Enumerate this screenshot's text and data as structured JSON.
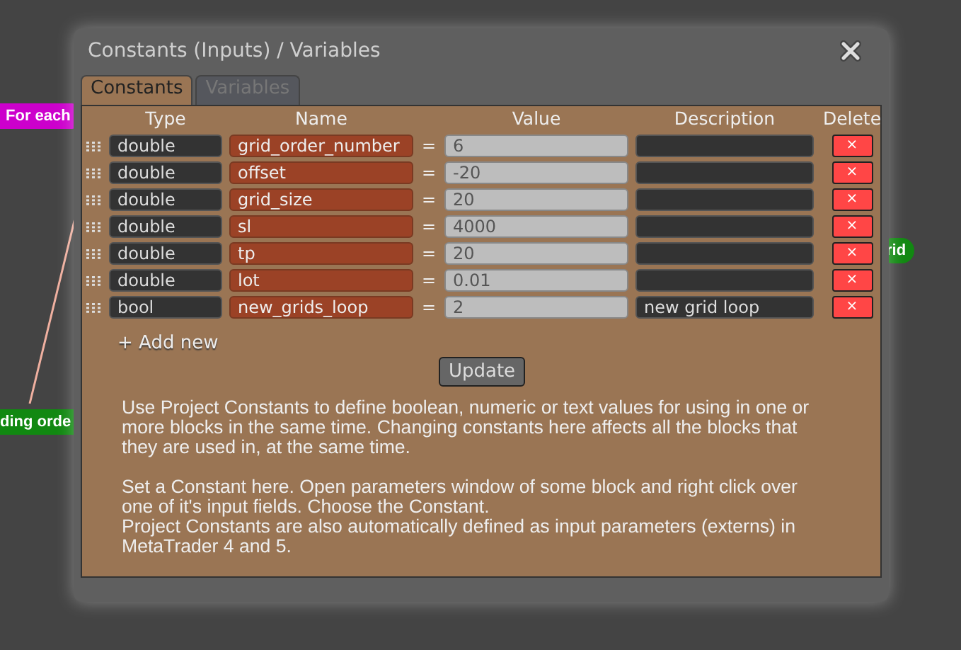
{
  "canvas_nodes": [
    {
      "label": "For each",
      "color": "#cc00cc"
    },
    {
      "label": "rid",
      "color": "#118811"
    },
    {
      "label": "ding orde",
      "color": "#118811"
    }
  ],
  "dialog": {
    "title": "Constants (Inputs) / Variables",
    "tabs": [
      {
        "label": "Constants",
        "selected": true
      },
      {
        "label": "Variables",
        "selected": false
      }
    ],
    "table": {
      "columns": [
        "Type",
        "Name",
        "Value",
        "Description",
        "Delete"
      ],
      "rows": [
        {
          "type": "double",
          "name": "grid_order_number",
          "equals": "=",
          "value": "6",
          "delete": "×"
        },
        {
          "type": "double",
          "name": "offset",
          "equals": "=",
          "value": "-20",
          "delete": "×"
        },
        {
          "type": "double",
          "name": "grid_size",
          "equals": "=",
          "value": "20",
          "delete": "×"
        },
        {
          "type": "double",
          "name": "sl",
          "equals": "=",
          "value": "4000",
          "delete": "×"
        },
        {
          "type": "double",
          "name": "tp",
          "equals": "=",
          "value": "20",
          "delete": "×"
        },
        {
          "type": "double",
          "name": "lot",
          "equals": "=",
          "value": "0.01",
          "delete": "×"
        },
        {
          "type": "bool",
          "name": "new_grids_loop",
          "equals": "=",
          "value": "2",
          "description": "new grid loop",
          "delete": "×"
        }
      ]
    },
    "add_new": "+ Add new",
    "update_button": "Update",
    "help": [
      "Use Project Constants to define boolean, numeric or text values for using in one or more blocks in the same time. Changing constants here affects all the blocks that they are used in, at the same time.",
      "Set a Constant here. Open parameters window of some block and right click over one of it's input fields. Choose the Constant.",
      "Project Constants are also automatically defined as input parameters (externs) in MetaTrader 4 and 5."
    ]
  }
}
